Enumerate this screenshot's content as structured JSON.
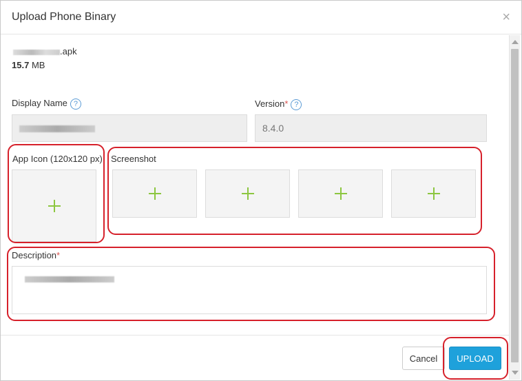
{
  "dialog": {
    "title": "Upload Phone Binary",
    "close_symbol": "×"
  },
  "file": {
    "name_ext": ".apk",
    "size_value": "15.7",
    "size_unit": "MB"
  },
  "form": {
    "display_name_label": "Display Name",
    "help_symbol": "?",
    "version_label": "Version",
    "required_mark": "*",
    "version_value": "8.4.0",
    "app_icon_label": "App Icon (120x120 px)",
    "screenshot_label": "Screenshot",
    "description_label": "Description"
  },
  "footer": {
    "cancel_label": "Cancel",
    "upload_label": "UPLOAD"
  },
  "colors": {
    "accent": "#1ea1db",
    "plus": "#8cc63f",
    "highlight": "#d6202a",
    "required": "#d9534f"
  },
  "icons": [
    "close-icon",
    "help-icon",
    "plus-icon"
  ]
}
